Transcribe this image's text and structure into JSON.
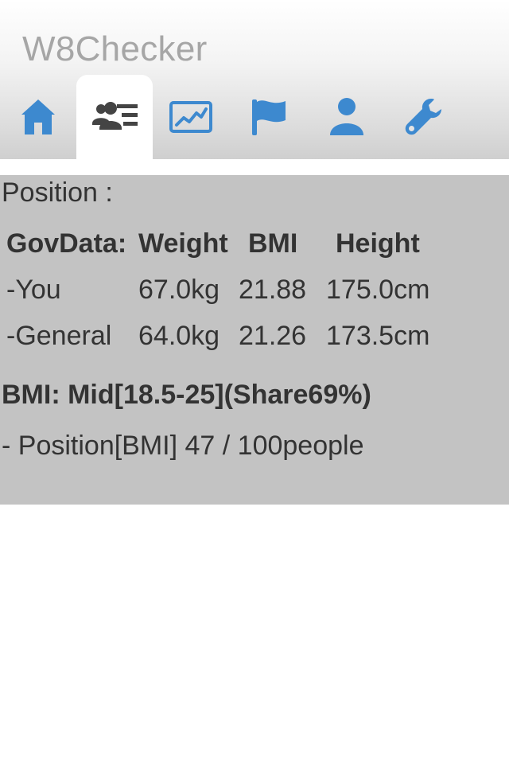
{
  "app": {
    "title": "W8Checker"
  },
  "tabs": [
    {
      "icon": "home-icon",
      "active": false
    },
    {
      "icon": "people-list-icon",
      "active": true
    },
    {
      "icon": "chart-icon",
      "active": false
    },
    {
      "icon": "flag-icon",
      "active": false
    },
    {
      "icon": "user-icon",
      "active": false
    },
    {
      "icon": "wrench-icon",
      "active": false
    }
  ],
  "colors": {
    "accent": "#3d89cf",
    "active_icon": "#444444",
    "panel_bg": "#c3c3c3",
    "text": "#333333",
    "title": "#a6a6a6"
  },
  "panel": {
    "position_label": "Position :",
    "table": {
      "headers": [
        "GovData:",
        "Weight",
        "BMI",
        "Height"
      ],
      "rows": [
        [
          "-You",
          "67.0kg",
          "21.88",
          "175.0cm"
        ],
        [
          "-General",
          "64.0kg",
          "21.26",
          "173.5cm"
        ]
      ]
    },
    "bmi_summary": "BMI: Mid[18.5-25](Share69%)",
    "bmi_position": "- Position[BMI] 47 / 100people"
  }
}
